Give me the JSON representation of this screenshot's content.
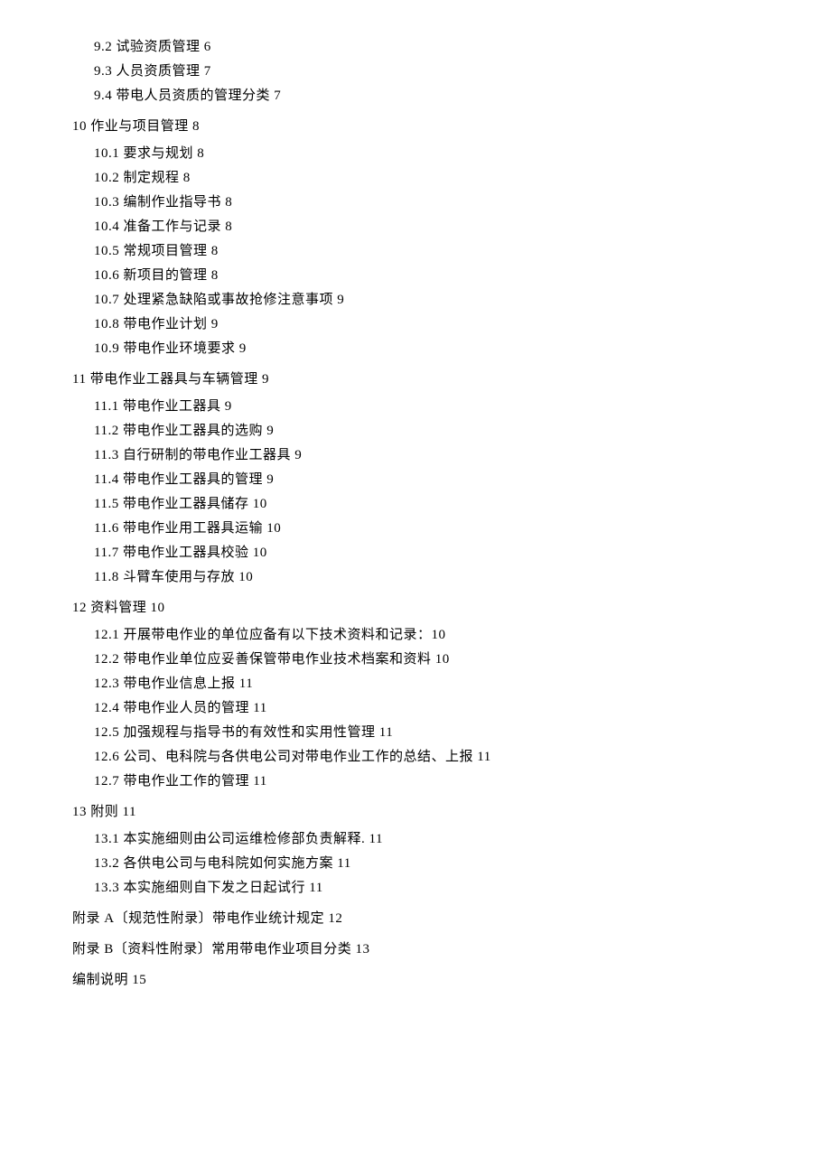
{
  "toc": [
    {
      "level": 2,
      "text": "9.2 试验资质管理 6"
    },
    {
      "level": 2,
      "text": "9.3 人员资质管理 7"
    },
    {
      "level": 2,
      "text": "9.4 带电人员资质的管理分类 7"
    },
    {
      "level": 1,
      "text": "10 作业与项目管理 8"
    },
    {
      "level": 2,
      "text": "10.1 要求与规划 8"
    },
    {
      "level": 2,
      "text": "10.2 制定规程 8"
    },
    {
      "level": 2,
      "text": "10.3 编制作业指导书 8"
    },
    {
      "level": 2,
      "text": "10.4 准备工作与记录 8"
    },
    {
      "level": 2,
      "text": "10.5 常规项目管理 8"
    },
    {
      "level": 2,
      "text": "10.6 新项目的管理 8"
    },
    {
      "level": 2,
      "text": "10.7 处理紧急缺陷或事故抢修注意事项 9"
    },
    {
      "level": 2,
      "text": "10.8 带电作业计划 9"
    },
    {
      "level": 2,
      "text": "10.9 带电作业环境要求 9"
    },
    {
      "level": 1,
      "text": "11 带电作业工器具与车辆管理 9"
    },
    {
      "level": 2,
      "text": "11.1 带电作业工器具 9"
    },
    {
      "level": 2,
      "text": "11.2 带电作业工器具的选购 9"
    },
    {
      "level": 2,
      "text": "11.3 自行研制的带电作业工器具 9"
    },
    {
      "level": 2,
      "text": "11.4 带电作业工器具的管理 9"
    },
    {
      "level": 2,
      "text": "11.5 带电作业工器具储存 10"
    },
    {
      "level": 2,
      "text": "11.6 带电作业用工器具运输 10"
    },
    {
      "level": 2,
      "text": "11.7 带电作业工器具校验 10"
    },
    {
      "level": 2,
      "text": "11.8 斗臂车使用与存放 10"
    },
    {
      "level": 1,
      "text": "12 资料管理 10"
    },
    {
      "level": 2,
      "text": "12.1 开展带电作业的单位应备有以下技术资料和记录：10"
    },
    {
      "level": 2,
      "text": "12.2 带电作业单位应妥善保管带电作业技术档案和资料 10"
    },
    {
      "level": 2,
      "text": "12.3 带电作业信息上报 11"
    },
    {
      "level": 2,
      "text": "12.4 带电作业人员的管理 11"
    },
    {
      "level": 2,
      "text": "12.5 加强规程与指导书的有效性和实用性管理 11"
    },
    {
      "level": 2,
      "text": "12.6 公司、电科院与各供电公司对带电作业工作的总结、上报 11"
    },
    {
      "level": 2,
      "text": "12.7 带电作业工作的管理 11"
    },
    {
      "level": 1,
      "text": "13 附则 11"
    },
    {
      "level": 2,
      "text": "13.1 本实施细则由公司运维检修部负责解释. 11"
    },
    {
      "level": 2,
      "text": "13.2 各供电公司与电科院如何实施方案 11"
    },
    {
      "level": 2,
      "text": "13.3 本实施细则自下发之日起试行 11"
    },
    {
      "level": 1,
      "text": "附录 A〔规范性附录〕带电作业统计规定 12"
    },
    {
      "level": 1,
      "text": "附录 B〔资料性附录〕常用带电作业项目分类 13"
    },
    {
      "level": 1,
      "text": "编制说明 15"
    }
  ]
}
